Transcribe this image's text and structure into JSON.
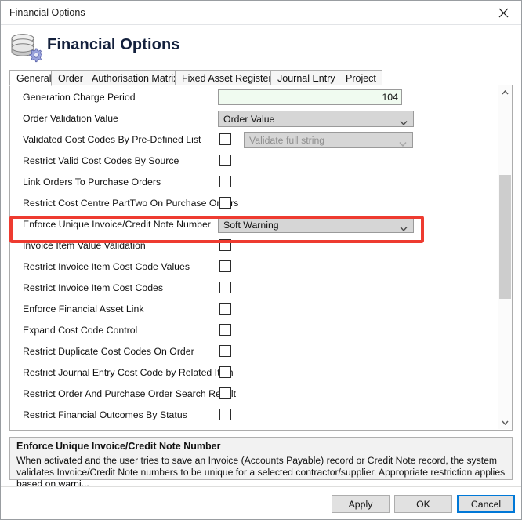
{
  "window": {
    "titlebar_text": "Financial Options",
    "close_icon": "close-icon"
  },
  "header": {
    "page_title": "Financial Options",
    "icon": "coins-gear-icon"
  },
  "tabs": [
    {
      "label": "General",
      "active": true
    },
    {
      "label": "Order",
      "active": false
    },
    {
      "label": "Authorisation Matrix",
      "active": false
    },
    {
      "label": "Fixed Asset Register",
      "active": false
    },
    {
      "label": "Journal Entry",
      "active": false
    },
    {
      "label": "Project",
      "active": false
    }
  ],
  "form": {
    "rows": [
      {
        "label": "Generation Charge Period",
        "control": "text",
        "value": "104"
      },
      {
        "label": "Order Validation Value",
        "control": "dropdown",
        "value": "Order Value",
        "disabled": false
      },
      {
        "label": "Validated Cost Codes By Pre-Defined List",
        "control": "checkbox+dropdown",
        "checked": false,
        "value": "Validate full string",
        "disabled": true
      },
      {
        "label": "Restrict Valid Cost Codes By Source",
        "control": "checkbox",
        "checked": false
      },
      {
        "label": "Link Orders To Purchase Orders",
        "control": "checkbox",
        "checked": false
      },
      {
        "label": "Restrict Cost Centre PartTwo On Purchase Orders",
        "control": "checkbox",
        "checked": false
      },
      {
        "label": "Enforce Unique Invoice/Credit Note Number",
        "control": "dropdown",
        "value": "Soft Warning",
        "disabled": false,
        "highlighted": true
      },
      {
        "label": "Invoice Item Value Validation",
        "control": "checkbox",
        "checked": false
      },
      {
        "label": "Restrict Invoice Item Cost Code Values",
        "control": "checkbox",
        "checked": false
      },
      {
        "label": "Restrict Invoice Item Cost Codes",
        "control": "checkbox",
        "checked": false
      },
      {
        "label": "Enforce Financial Asset Link",
        "control": "checkbox",
        "checked": false
      },
      {
        "label": "Expand Cost Code Control",
        "control": "checkbox",
        "checked": false
      },
      {
        "label": "Restrict Duplicate Cost Codes On Order",
        "control": "checkbox",
        "checked": false
      },
      {
        "label": "Restrict Journal Entry Cost Code by Related Item",
        "control": "checkbox",
        "checked": false
      },
      {
        "label": "Restrict Order And Purchase Order Search Result",
        "control": "checkbox",
        "checked": false
      },
      {
        "label": "Restrict Financial Outcomes By Status",
        "control": "checkbox",
        "checked": false
      }
    ]
  },
  "scrollbar": {
    "up_icon": "chevron-up-icon",
    "down_icon": "chevron-down-icon"
  },
  "description": {
    "title": "Enforce Unique Invoice/Credit Note Number",
    "body": "When activated and the user tries to save an Invoice (Accounts Payable) record or Credit Note record, the system validates Invoice/Credit Note numbers to be unique for a selected contractor/supplier. Appropriate restriction applies based on warni..."
  },
  "footer": {
    "apply_label": "Apply",
    "ok_label": "OK",
    "cancel_label": "Cancel"
  },
  "colors": {
    "annotation_red": "#ee3b30",
    "focus_blue": "#0078d7",
    "input_green": "#f0fbf0",
    "dropdown_gray": "#d6d6d6"
  }
}
